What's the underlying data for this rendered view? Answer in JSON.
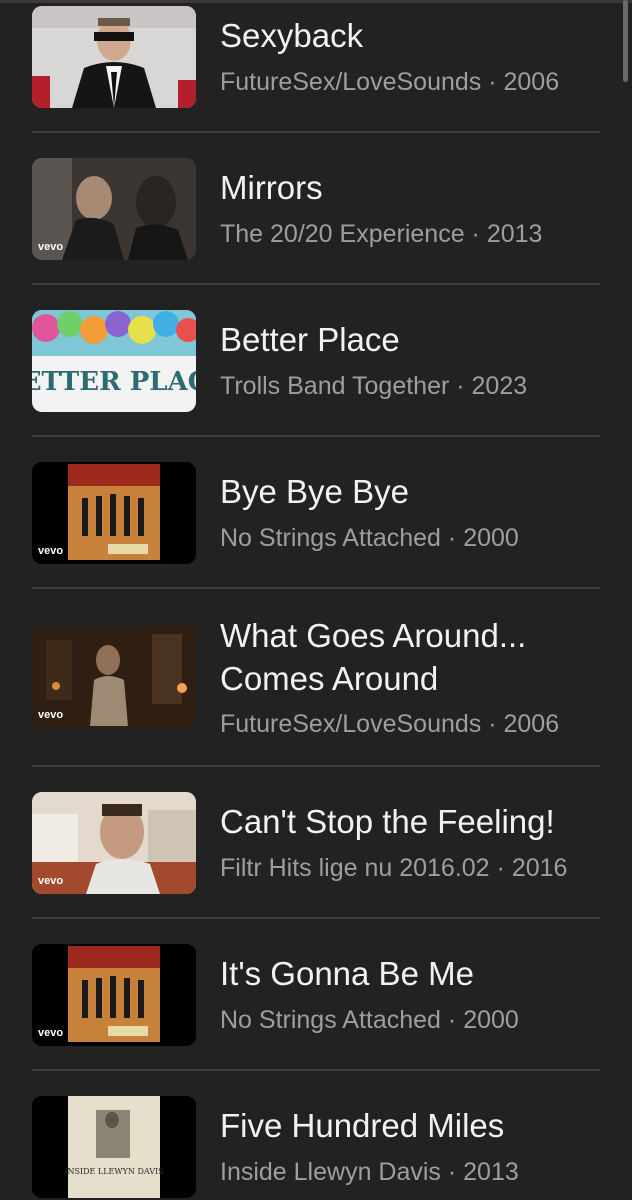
{
  "songs": [
    {
      "title": "Sexyback",
      "title_line2": "",
      "album": "FutureSex/LoveSounds",
      "year": "2006",
      "separator": " · ",
      "thumb": "suit-man-thumbnail"
    },
    {
      "title": "Mirrors",
      "title_line2": "",
      "album": "The 20/20 Experience",
      "year": "2013",
      "separator": " · ",
      "thumb": "vevo-video-thumbnail",
      "badge": "vevo"
    },
    {
      "title": "Better Place",
      "title_line2": "",
      "album": "Trolls Band Together",
      "year": "2023",
      "separator": " · ",
      "thumb": "trolls-thumbnail",
      "thumb_text": "BETTER PLACE"
    },
    {
      "title": "Bye Bye Bye",
      "title_line2": "",
      "album": "No Strings Attached",
      "year": "2000",
      "separator": " · ",
      "thumb": "nsync-album-thumbnail",
      "badge": "vevo"
    },
    {
      "title": "What Goes Around...",
      "title_line2": "Comes Around",
      "album": "FutureSex/LoveSounds",
      "year": "2006",
      "separator": " · ",
      "thumb": "dark-stage-thumbnail",
      "badge": "vevo"
    },
    {
      "title": "Can't Stop the Feeling!",
      "title_line2": "",
      "album": "Filtr Hits lige nu 2016.02",
      "year": "2016",
      "separator": " · ",
      "thumb": "selfie-video-thumbnail",
      "badge": "vevo"
    },
    {
      "title": "It's Gonna Be Me",
      "title_line2": "",
      "album": "No Strings Attached",
      "year": "2000",
      "separator": " · ",
      "thumb": "nsync-album-thumbnail",
      "badge": "vevo"
    },
    {
      "title": "Five Hundred Miles",
      "title_line2": "",
      "album": "Inside Llewyn Davis",
      "year": "2013",
      "separator": " · ",
      "thumb": "film-poster-thumbnail",
      "thumb_text": "INSIDE LLEWYN DAVIS"
    }
  ],
  "colors": {
    "background": "#222222",
    "title": "#f2f2f2",
    "subtitle": "#9e9e9e",
    "divider": "#3d3d3d"
  }
}
